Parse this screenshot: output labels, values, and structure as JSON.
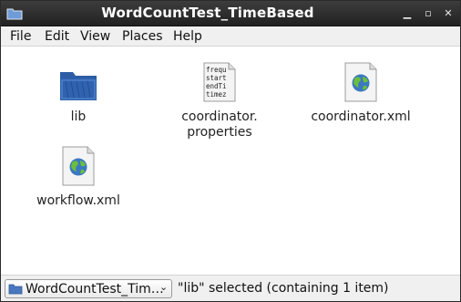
{
  "window": {
    "title": "WordCountTest_TimeBased",
    "controls": {
      "minimize": "▁",
      "maximize": "▫",
      "close": "✕"
    }
  },
  "menu": {
    "items": [
      "File",
      "Edit",
      "View",
      "Places",
      "Help"
    ]
  },
  "files": [
    {
      "name": "lib",
      "icon": "folder-icon",
      "selected": true
    },
    {
      "name": "coordinator.\nproperties",
      "icon": "text-file-icon",
      "preview": [
        "frequ",
        "start",
        "endTi",
        "timez"
      ]
    },
    {
      "name": "coordinator.xml",
      "icon": "xml-globe-file-icon"
    },
    {
      "name": "workflow.xml",
      "icon": "xml-globe-file-icon"
    }
  ],
  "statusbar": {
    "path_label": "WordCountTest_Tim…",
    "status": "\"lib\" selected (containing 1 item)"
  },
  "colors": {
    "titlebar": "#2e2e2e",
    "selection": "#7ea6d6",
    "folder": "#2f5fa8"
  }
}
